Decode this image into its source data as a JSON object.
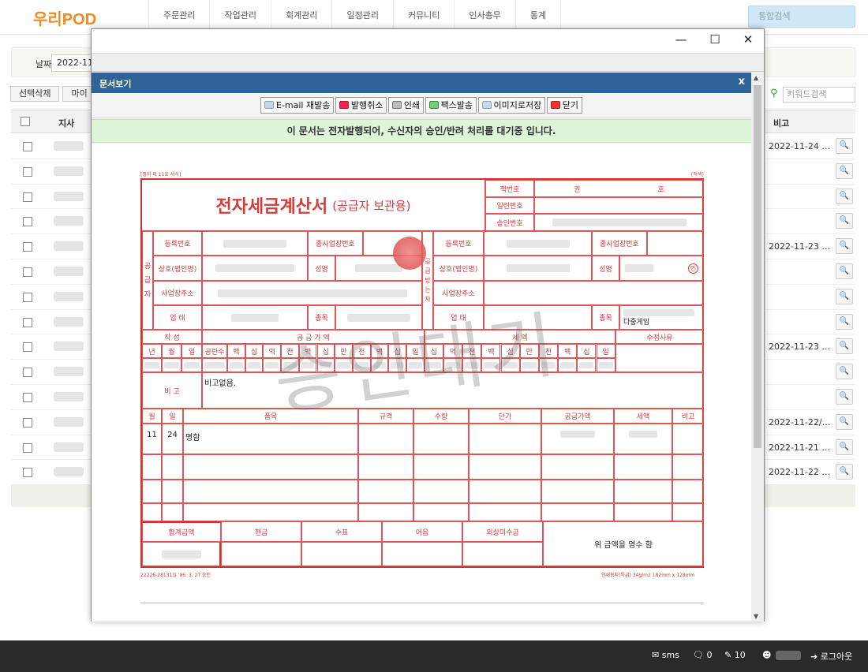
{
  "app": {
    "logo": "우리POD"
  },
  "nav": [
    "주문관리",
    "작업관리",
    "회계관리",
    "일정관리",
    "커뮤니티",
    "인사총무",
    "통계"
  ],
  "top_search": {
    "placeholder": "통합검색"
  },
  "filter": {
    "date_label": "날짜",
    "date_value": "2022-11"
  },
  "actions": {
    "delete_selected": "선택삭제",
    "my": "마이"
  },
  "keyword_search": {
    "placeholder": "키워드검색"
  },
  "table": {
    "headers": {
      "branch": "지사",
      "note": "비고"
    },
    "rows": [
      {
        "note_date": "2022-11-24 …"
      },
      {
        "note_date": ""
      },
      {
        "note_date": ""
      },
      {
        "note_date": ""
      },
      {
        "note_date": "2022-11-23 …"
      },
      {
        "note_date": ""
      },
      {
        "note_date": ""
      },
      {
        "note_date": ""
      },
      {
        "note_date": "2022-11-23 …"
      },
      {
        "note_date": ""
      },
      {
        "note_date": ""
      },
      {
        "note_date": "2022-11-22/…"
      },
      {
        "note_date": "2022-11-21 …"
      },
      {
        "note_date": "2022-11-22 …"
      }
    ]
  },
  "statusbar": {
    "sms": "sms",
    "chat_count": "0",
    "edit_count": "10",
    "logout": "로그아웃"
  },
  "window": {
    "minimize": "—",
    "maximize": "☐",
    "close": "✕"
  },
  "dialog": {
    "title": "문서보기",
    "close": "x",
    "toolbar": [
      "E-mail 재발송",
      "발행취소",
      "인쇄",
      "팩스발송",
      "이미지로저장",
      "닫기"
    ],
    "notice": "이 문서는 전자발행되어, 수신자의 승인/반려 처리를 대기중 입니다."
  },
  "invoice": {
    "form_no": "[별지 제 11호 서식]",
    "form_tag": "[적색]",
    "title": "전자세금계산서",
    "subtitle": "(공급자 보관용)",
    "book_no": "책번호",
    "book_kwon": "권",
    "book_ho": "호",
    "serial_no": "일련번호",
    "approval_no": "승인번호",
    "supplier_label": "공급자",
    "receiver_label": "공급받는자",
    "reg_no": "등록번호",
    "sub_biz_no": "종사업장번호",
    "company": "상호(법인명)",
    "name": "성명",
    "address": "사업장주소",
    "biz_type": "업 태",
    "biz_item": "종목",
    "receiver_item_fragment": "다중게임",
    "seal_char": "인",
    "written": "작 성",
    "supply_amount": "공 급 가 액",
    "tax_amount": "세 액",
    "revision": "수정사유",
    "year": "년",
    "month": "월",
    "day": "일",
    "blanks": "공란수",
    "digits_supply": [
      "백",
      "십",
      "억",
      "천",
      "백",
      "십",
      "만",
      "천",
      "백",
      "십",
      "일"
    ],
    "digits_tax": [
      "십",
      "억",
      "천",
      "백",
      "십",
      "만",
      "천",
      "백",
      "십",
      "일"
    ],
    "remarks_label": "비 고",
    "remarks_value": "비고없음.",
    "item_headers": [
      "월",
      "일",
      "품목",
      "규격",
      "수량",
      "단가",
      "공급가액",
      "세액",
      "비고"
    ],
    "item_row": {
      "month": "11",
      "day": "24",
      "name": "명함"
    },
    "total_label": "합계금액",
    "cash": "현금",
    "check": "수표",
    "note": "어음",
    "credit": "외상미수금",
    "receipt": "위 금액을 영수 함",
    "footer_left": "22226-28131일  '96. 3. 27 승인",
    "footer_right": "인쇄용지(특급) 34g/m2 182mm x 128mm",
    "watermark": "승인대기"
  }
}
